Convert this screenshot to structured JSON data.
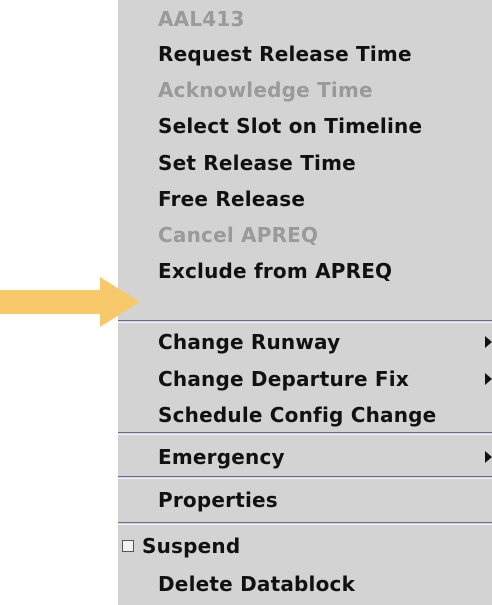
{
  "menu": {
    "title": "AAL413",
    "items": [
      {
        "label": "Request Release Time",
        "enabled": true
      },
      {
        "label": "Acknowledge Time",
        "enabled": false
      },
      {
        "label": "Select Slot on Timeline",
        "enabled": true
      },
      {
        "label": "Set Release Time",
        "enabled": true
      },
      {
        "label": "Free Release",
        "enabled": true
      },
      {
        "label": "Cancel APREQ",
        "enabled": false
      },
      {
        "label": "Exclude from APREQ",
        "enabled": true,
        "highlighted_by_annotation": true
      },
      {
        "label": "Change Runway",
        "enabled": true,
        "submenu": true
      },
      {
        "label": "Change Departure Fix",
        "enabled": true,
        "submenu": true
      },
      {
        "label": "Schedule Config Change",
        "enabled": true
      },
      {
        "label": "Emergency",
        "enabled": true,
        "submenu": true
      },
      {
        "label": "Properties",
        "enabled": true
      },
      {
        "label": "Suspend",
        "enabled": true,
        "checkbox": true,
        "checked": false
      },
      {
        "label": "Delete Datablock",
        "enabled": true
      }
    ]
  },
  "annotation": {
    "icon": "arrow-right-icon",
    "color": "#f7c96a"
  },
  "colors": {
    "menu_background": "#d3d3d3",
    "text": "#111111",
    "disabled_text": "#9a9a9a",
    "separator": "#6a6a9a"
  }
}
